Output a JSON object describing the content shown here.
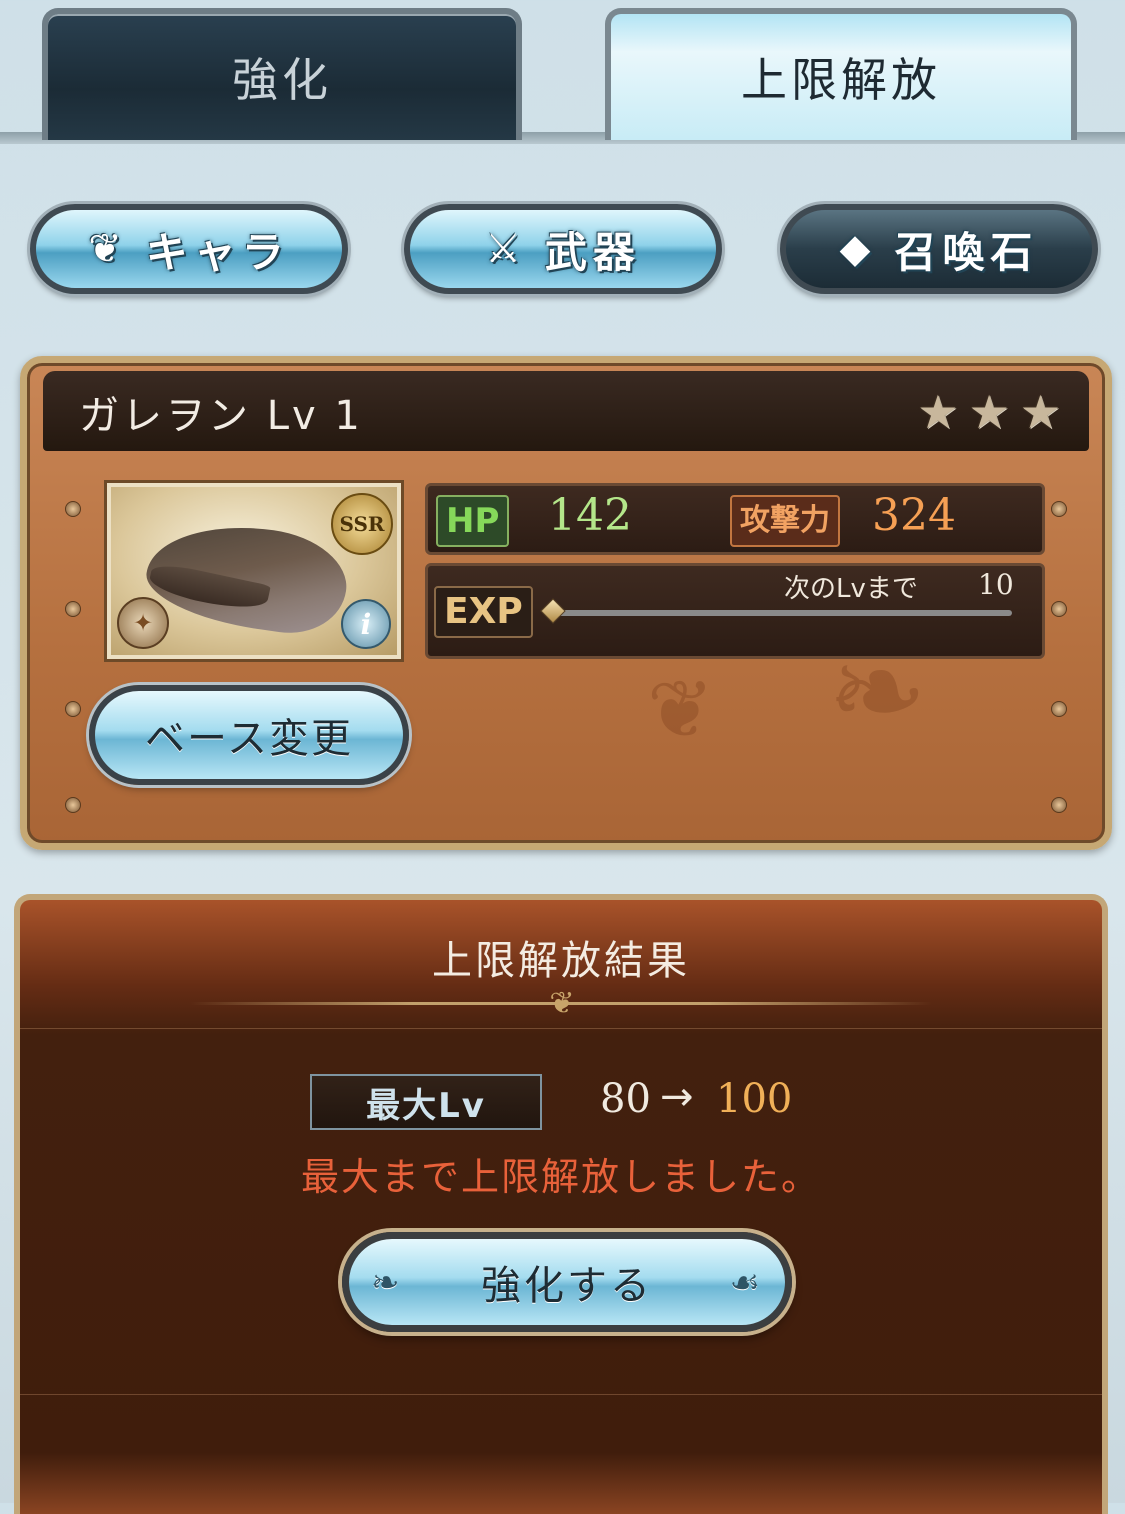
{
  "tabs": [
    {
      "label": "強化",
      "active": false
    },
    {
      "label": "上限解放",
      "active": true
    }
  ],
  "categories": [
    {
      "label": "キャラ",
      "icon": "winged-emblem-icon"
    },
    {
      "label": "武器",
      "icon": "crossed-weapons-icon"
    },
    {
      "label": "召喚石",
      "icon": "crystal-icon"
    }
  ],
  "character": {
    "name": "ガレヲン Lv 1",
    "rarity_stars": 3,
    "rarity_badge": "SSR",
    "hp_label": "HP",
    "hp": "142",
    "atk_label": "攻撃力",
    "atk": "324",
    "exp_label": "EXP",
    "next_level_label": "次のLvまで",
    "next_level_exp": "10",
    "exp_progress": 0,
    "base_change_label": "ベース変更"
  },
  "result": {
    "title": "上限解放結果",
    "max_lv_label": "最大Lv",
    "max_lv_from": "80",
    "arrow": "→",
    "max_lv_to": "100",
    "message": "最大まで上限解放しました。",
    "enhance_button": "強化する"
  },
  "colors": {
    "hp": "#b4e68a",
    "atk": "#f6a054",
    "message": "#e8613a",
    "max_lv_to": "#f0b058"
  }
}
